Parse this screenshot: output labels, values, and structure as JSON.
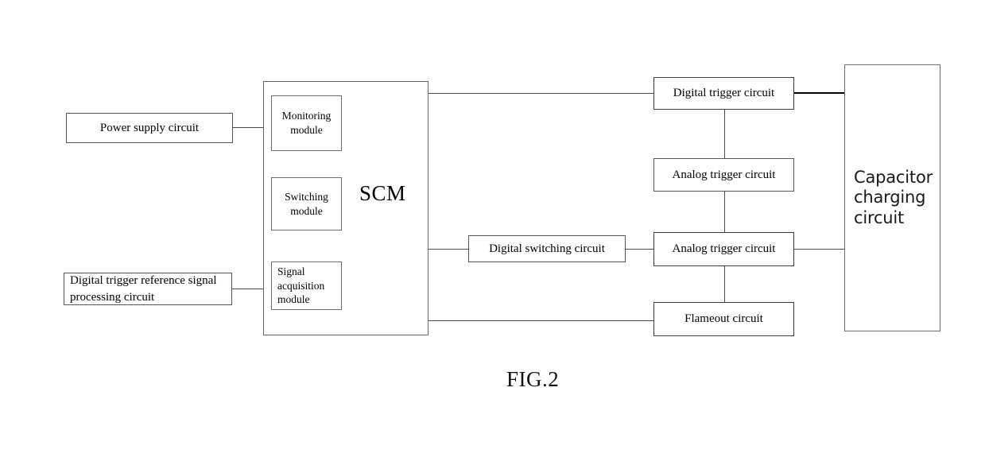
{
  "figure": {
    "caption": "FIG.2",
    "accent_color": "#000000",
    "line_color": "#4a4a4a",
    "box_border_color": "#555555",
    "background": "#ffffff"
  },
  "blocks": {
    "power_supply": {
      "label": "Power supply circuit"
    },
    "digital_trigger_reference": {
      "line1": "Digital trigger reference signal",
      "line2": "processing circuit"
    },
    "scm": {
      "label": "SCM"
    },
    "monitoring_module": {
      "line1": "Monitoring",
      "line2": "module"
    },
    "switching_module": {
      "line1": "Switching",
      "line2": "module"
    },
    "signal_acquisition_module": {
      "line1": "Signal",
      "line2": "acquisition",
      "line3": "module"
    },
    "digital_switching": {
      "label": "Digital switching circuit"
    },
    "digital_trigger": {
      "label": "Digital trigger circuit"
    },
    "analog_trigger_upper": {
      "label": "Analog trigger circuit"
    },
    "analog_trigger_lower": {
      "label": "Analog trigger circuit"
    },
    "flameout": {
      "label": "Flameout circuit"
    },
    "capacitor_charging": {
      "line1": "Capacitor",
      "line2": "charging",
      "line3": "circuit"
    }
  }
}
